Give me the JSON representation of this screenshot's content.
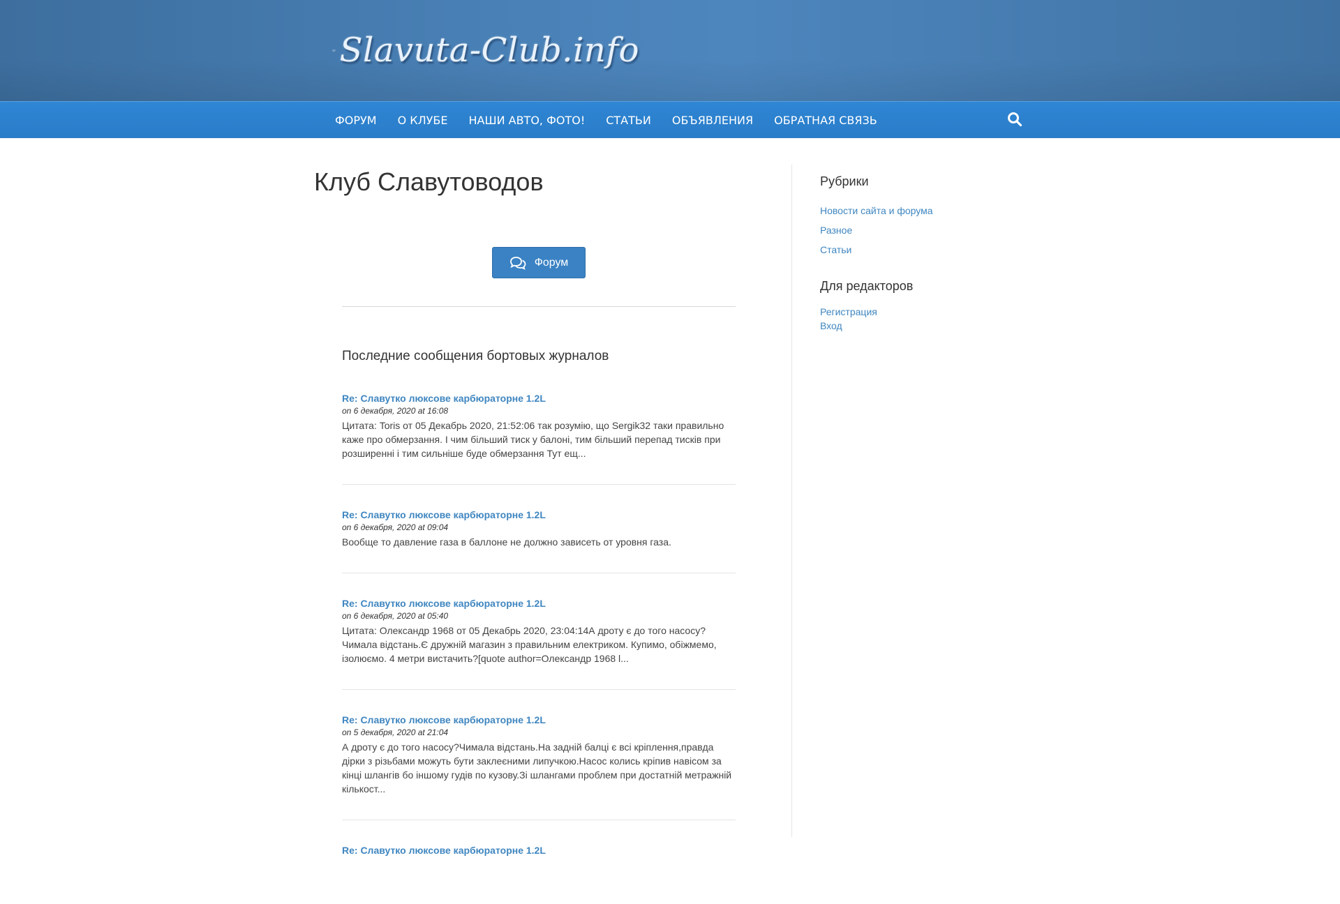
{
  "header": {
    "logo_text": "Slavuta-Club.info"
  },
  "nav": {
    "items": [
      {
        "label": "Форум"
      },
      {
        "label": "О клубе"
      },
      {
        "label": "Наши авто, фото!"
      },
      {
        "label": "Статьи"
      },
      {
        "label": "Объявления"
      },
      {
        "label": "Обратная связь"
      }
    ],
    "search_icon": "search-icon"
  },
  "main": {
    "title": "Клуб Славутоводов",
    "forum_button": {
      "label": "Форум",
      "icon": "chat-bubbles-icon"
    },
    "section_title": "Последние сообщения бортовых журналов",
    "posts": [
      {
        "title": "Re: Славутко люксове карбюраторне 1.2L",
        "date": "on 6 декабря, 2020 at 16:08",
        "excerpt": "Цитата: Toris от 05 Декабрь 2020, 21:52:06 так розумію, що Sergik32 таки правильно каже про обмерзання. І чим більший тиск у балоні, тим більший перепад тисків при розширенні і тим сильніше буде обмерзання Тут ещ..."
      },
      {
        "title": "Re: Славутко люксове карбюраторне 1.2L",
        "date": "on 6 декабря, 2020 at 09:04",
        "excerpt": "Вообще то давление газа в баллоне не должно зависеть от уровня газа."
      },
      {
        "title": "Re: Славутко люксове карбюраторне 1.2L",
        "date": "on 6 декабря, 2020 at 05:40",
        "excerpt": "Цитата: Олександр 1968 от 05 Декабрь 2020, 23:04:14А дроту є до того насосу? Чимала відстань.Є дружній магазин з правильним електриком. Купимо, обіжмемо, ізолюємо. 4 метри вистачить?[quote author=Олександр 1968 l..."
      },
      {
        "title": "Re: Славутко люксове карбюраторне 1.2L",
        "date": "on 5 декабря, 2020 at 21:04",
        "excerpt": "А дроту є до того насосу?Чимала відстань.На задній балці є всі кріплення,правда дірки з різьбами можуть бути заклеєними липучкою.Насос колись кріпив навісом за кінці шлангів бо іншому гудів по кузову.Зі шлангами проблем при достатній метражній кількост..."
      },
      {
        "title": "Re: Славутко люксове карбюраторне 1.2L",
        "date": "",
        "excerpt": ""
      }
    ]
  },
  "sidebar": {
    "categories_title": "Рубрики",
    "categories": [
      {
        "label": "Новости сайта и форума"
      },
      {
        "label": "Разное"
      },
      {
        "label": "Статьи"
      }
    ],
    "editors_title": "Для редакторов",
    "editors_links": [
      {
        "label": "Регистрация"
      },
      {
        "label": "Вход"
      }
    ]
  },
  "colors": {
    "header_bg": "#4a82b8",
    "nav_bg": "#2f86d4",
    "link": "#3f86c0",
    "button_bg": "#3a82c4"
  }
}
